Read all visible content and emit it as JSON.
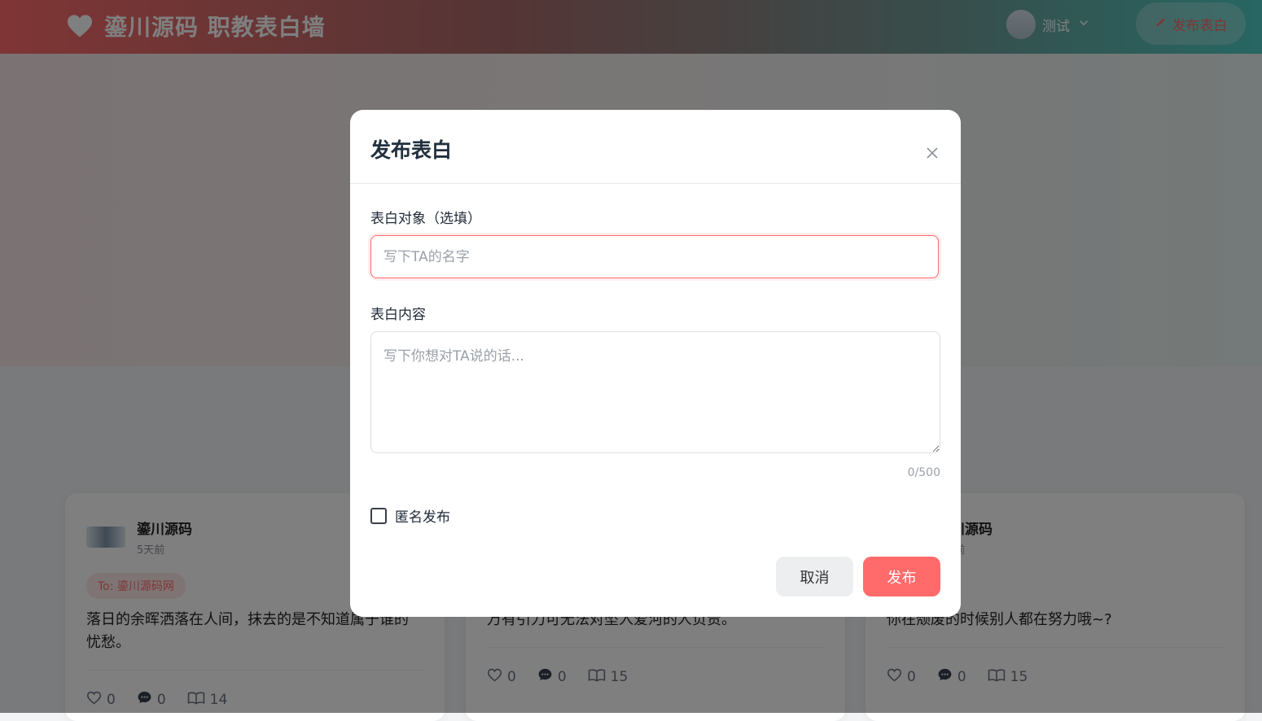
{
  "header": {
    "title": "鎏川源码 职教表白墙",
    "user_name": "测试",
    "publish_label": "发布表白"
  },
  "cards": [
    {
      "author": "鎏川源码",
      "time": "5天前",
      "to": "To: 鎏川源码网",
      "content": "落日的余晖洒落在人间，抹去的是不知道属于谁的忧愁。",
      "likes": "0",
      "comments": "0",
      "views": "14"
    },
    {
      "author": "",
      "time": "",
      "to": "",
      "content": "万有引力可无法对坠入爱河的人负责。",
      "likes": "0",
      "comments": "0",
      "views": "15"
    },
    {
      "author": "鎏川源码",
      "time": "5天前",
      "to": "",
      "content": "你在颓废的时候别人都在努力哦~?",
      "likes": "0",
      "comments": "0",
      "views": "15"
    }
  ],
  "modal": {
    "title": "发布表白",
    "target_label": "表白对象（选填）",
    "target_placeholder": "写下TA的名字",
    "target_value": "",
    "content_label": "表白内容",
    "content_placeholder": "写下你想对TA说的话...",
    "content_value": "",
    "counter": "0/500",
    "anonymous_label": "匿名发布",
    "anonymous_checked": false,
    "cancel_label": "取消",
    "submit_label": "发布"
  },
  "colors": {
    "accent": "#ff6b6b",
    "teal": "#4ecdc4"
  },
  "icons": {
    "brand": "heart-icon",
    "publish": "pencil-icon",
    "dropdown": "chevron-down-icon",
    "close": "close-icon",
    "like": "heart-outline-icon",
    "comment": "chat-bubble-icon",
    "view": "book-open-icon"
  }
}
